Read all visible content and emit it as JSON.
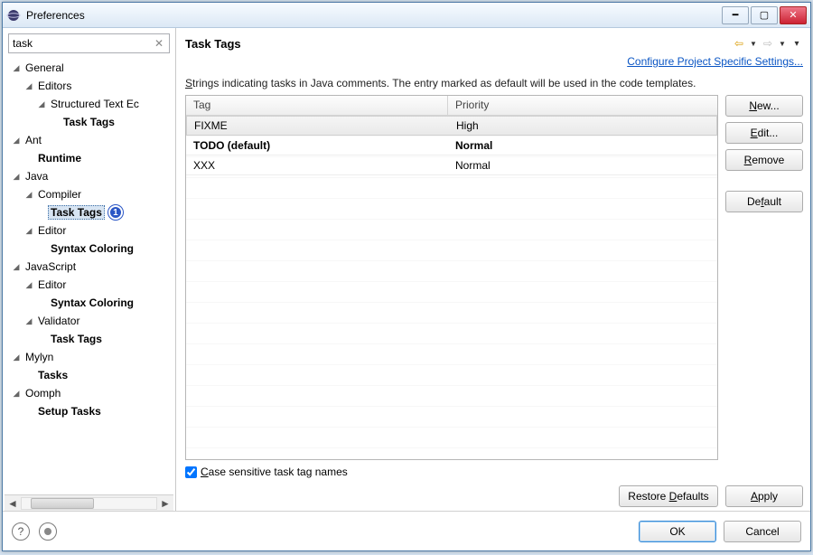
{
  "window": {
    "title": "Preferences"
  },
  "search": {
    "value": "task"
  },
  "tree": {
    "general": "General",
    "editors": "Editors",
    "structured": "Structured Text Ec",
    "task_tags_general": "Task Tags",
    "ant": "Ant",
    "runtime": "Runtime",
    "java": "Java",
    "compiler": "Compiler",
    "task_tags_java": "Task Tags",
    "java_editor": "Editor",
    "syntax_coloring_java": "Syntax Coloring",
    "javascript": "JavaScript",
    "js_editor": "Editor",
    "syntax_coloring_js": "Syntax Coloring",
    "validator": "Validator",
    "task_tags_js": "Task Tags",
    "mylyn": "Mylyn",
    "tasks": "Tasks",
    "oomph": "Oomph",
    "setup_tasks": "Setup Tasks",
    "badge": "1"
  },
  "page": {
    "title": "Task Tags",
    "configure_link": "Configure Project Specific Settings...",
    "description_pre": "S",
    "description_rest": "trings indicating tasks in Java comments. The entry marked as default will be used in the code templates."
  },
  "table": {
    "headers": {
      "tag": "Tag",
      "priority": "Priority"
    },
    "rows": [
      {
        "tag": "FIXME",
        "priority": "High",
        "selected": true,
        "bold": false
      },
      {
        "tag": "TODO (default)",
        "priority": "Normal",
        "selected": false,
        "bold": true
      },
      {
        "tag": "XXX",
        "priority": "Normal",
        "selected": false,
        "bold": false
      }
    ]
  },
  "buttons": {
    "new": "New...",
    "new_u": "N",
    "edit": "Edit...",
    "edit_post": "dit...",
    "edit_u": "E",
    "remove": "Remove",
    "remove_u": "R",
    "remove_post": "emove",
    "default": "Default",
    "default_u": "f",
    "default_pre": "De",
    "default_post": "ault",
    "restore": "Restore Defaults",
    "restore_u": "D",
    "apply": "Apply",
    "apply_u": "A",
    "ok": "OK",
    "cancel": "Cancel"
  },
  "checkbox": {
    "pre": "C",
    "rest": "ase sensitive task tag names",
    "checked": true
  }
}
